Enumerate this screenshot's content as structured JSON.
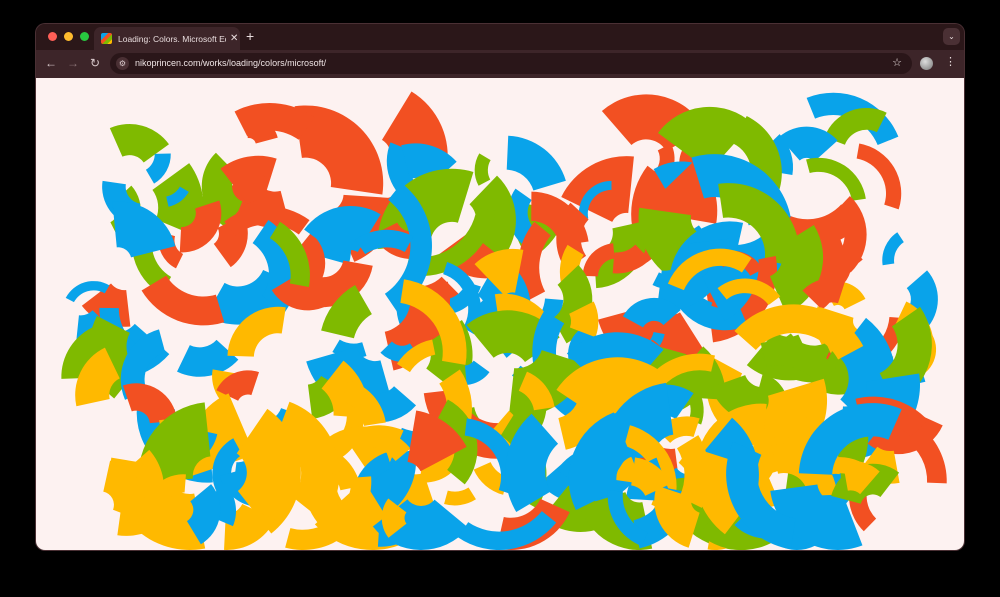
{
  "browser": {
    "tab_title": "Loading: Colors. Microsoft Edition",
    "tab_close": "✕",
    "new_tab": "+",
    "tab_menu": "⌄",
    "url": "nikoprincen.com/works/loading/colors/microsoft/",
    "back": "←",
    "forward": "→",
    "reload": "↻",
    "site_info": "⚙",
    "bookmark": "☆",
    "menu": "⋮"
  },
  "artwork": {
    "background": "#fdf2f1",
    "colors": [
      "#f25022",
      "#7fba00",
      "#09a3ea",
      "#ffb900"
    ]
  }
}
